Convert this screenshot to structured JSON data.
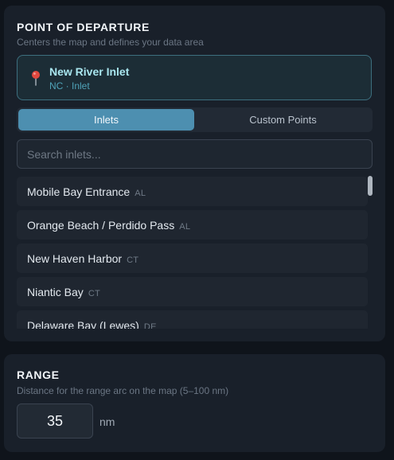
{
  "departure": {
    "title": "POINT OF DEPARTURE",
    "subtitle": "Centers the map and defines your data area",
    "selected": {
      "name": "New River Inlet",
      "meta": "NC · Inlet"
    },
    "tabs": [
      {
        "label": "Inlets",
        "active": true
      },
      {
        "label": "Custom Points",
        "active": false
      }
    ],
    "search": {
      "placeholder": "Search inlets...",
      "value": ""
    },
    "inlets": [
      {
        "name": "Mobile Bay Entrance",
        "state": "AL"
      },
      {
        "name": "Orange Beach / Perdido Pass",
        "state": "AL"
      },
      {
        "name": "New Haven Harbor",
        "state": "CT"
      },
      {
        "name": "Niantic Bay",
        "state": "CT"
      },
      {
        "name": "Delaware Bay (Lewes)",
        "state": "DE"
      }
    ]
  },
  "range": {
    "title": "RANGE",
    "subtitle": "Distance for the range arc on the map (5–100 nm)",
    "value": "35",
    "unit": "nm"
  },
  "colors": {
    "accent": "#4d8fb0",
    "panel": "#19202a",
    "background": "#0f141b",
    "pin": "#e0483f"
  }
}
